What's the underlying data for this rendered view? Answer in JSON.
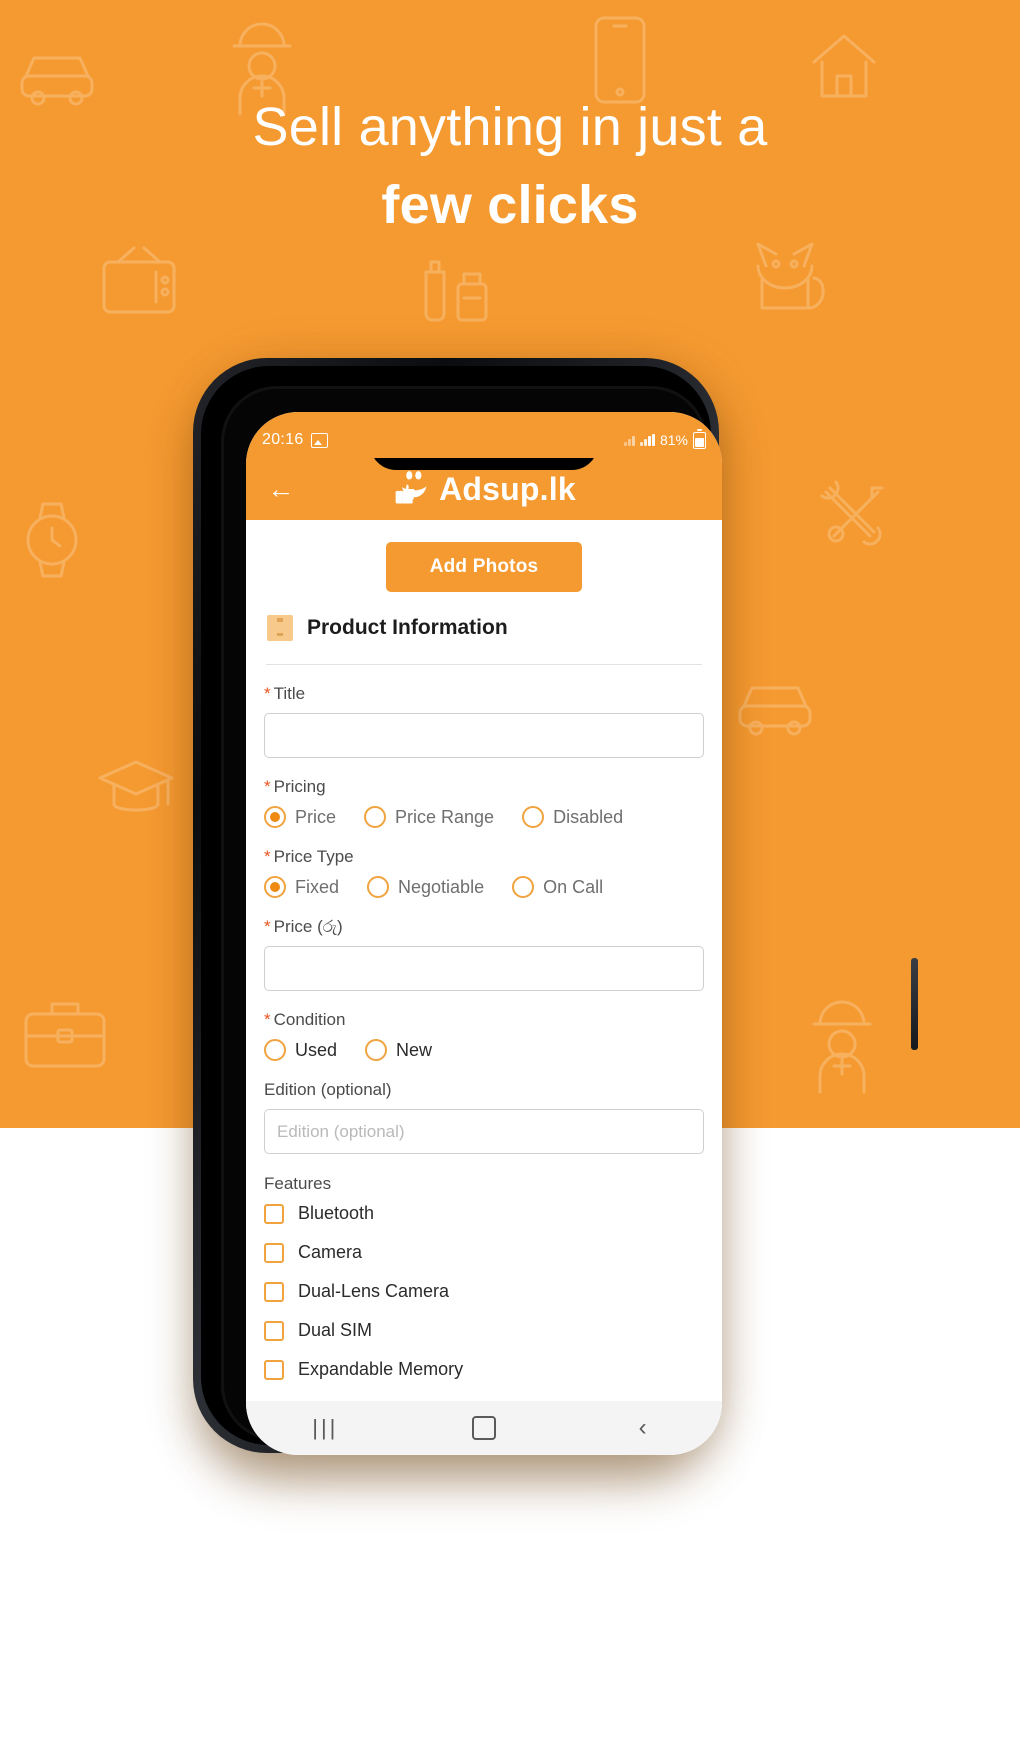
{
  "promo": {
    "headline_line1": "Sell anything in just a",
    "headline_line2": "few clicks",
    "bg_color": "#F59A31"
  },
  "status_bar": {
    "time": "20:16",
    "screenshot_icon": "image-icon",
    "signal_icon": "signal-bars-icon",
    "battery_text": "81%",
    "battery_icon": "battery-icon"
  },
  "app_bar": {
    "back_icon": "back-arrow-icon",
    "logo_icon": "adsup-smiley-thumbsup-logo-icon",
    "title": "Adsup.lk"
  },
  "form": {
    "add_photos_label": "Add Photos",
    "section": {
      "icon": "package-box-icon",
      "title": "Product Information"
    },
    "title_field": {
      "label": "Title",
      "required": true,
      "value": "",
      "placeholder": ""
    },
    "pricing": {
      "label": "Pricing",
      "required": true,
      "options": [
        {
          "label": "Price",
          "selected": true
        },
        {
          "label": "Price Range",
          "selected": false
        },
        {
          "label": "Disabled",
          "selected": false
        }
      ]
    },
    "price_type": {
      "label": "Price Type",
      "required": true,
      "options": [
        {
          "label": "Fixed",
          "selected": true
        },
        {
          "label": "Negotiable",
          "selected": false
        },
        {
          "label": "On Call",
          "selected": false
        }
      ]
    },
    "price_field": {
      "label": "Price (රු)",
      "required": true,
      "value": "",
      "placeholder": ""
    },
    "condition": {
      "label": "Condition",
      "required": true,
      "options": [
        {
          "label": "Used",
          "selected": false
        },
        {
          "label": "New",
          "selected": false
        }
      ]
    },
    "edition_field": {
      "label": "Edition (optional)",
      "required": false,
      "value": "",
      "placeholder": "Edition (optional)"
    },
    "features": {
      "label": "Features",
      "items": [
        {
          "label": "Bluetooth",
          "checked": false
        },
        {
          "label": "Camera",
          "checked": false
        },
        {
          "label": "Dual-Lens Camera",
          "checked": false
        },
        {
          "label": "Dual SIM",
          "checked": false
        },
        {
          "label": "Expandable Memory",
          "checked": false
        }
      ]
    }
  },
  "nav_bar": {
    "recents_label": "|||",
    "home_icon": "home-square-icon",
    "back_label": "‹"
  },
  "colors": {
    "brand_orange": "#F59A31",
    "accent_orange": "#EE8A12",
    "required_asterisk": "#E8541E"
  }
}
